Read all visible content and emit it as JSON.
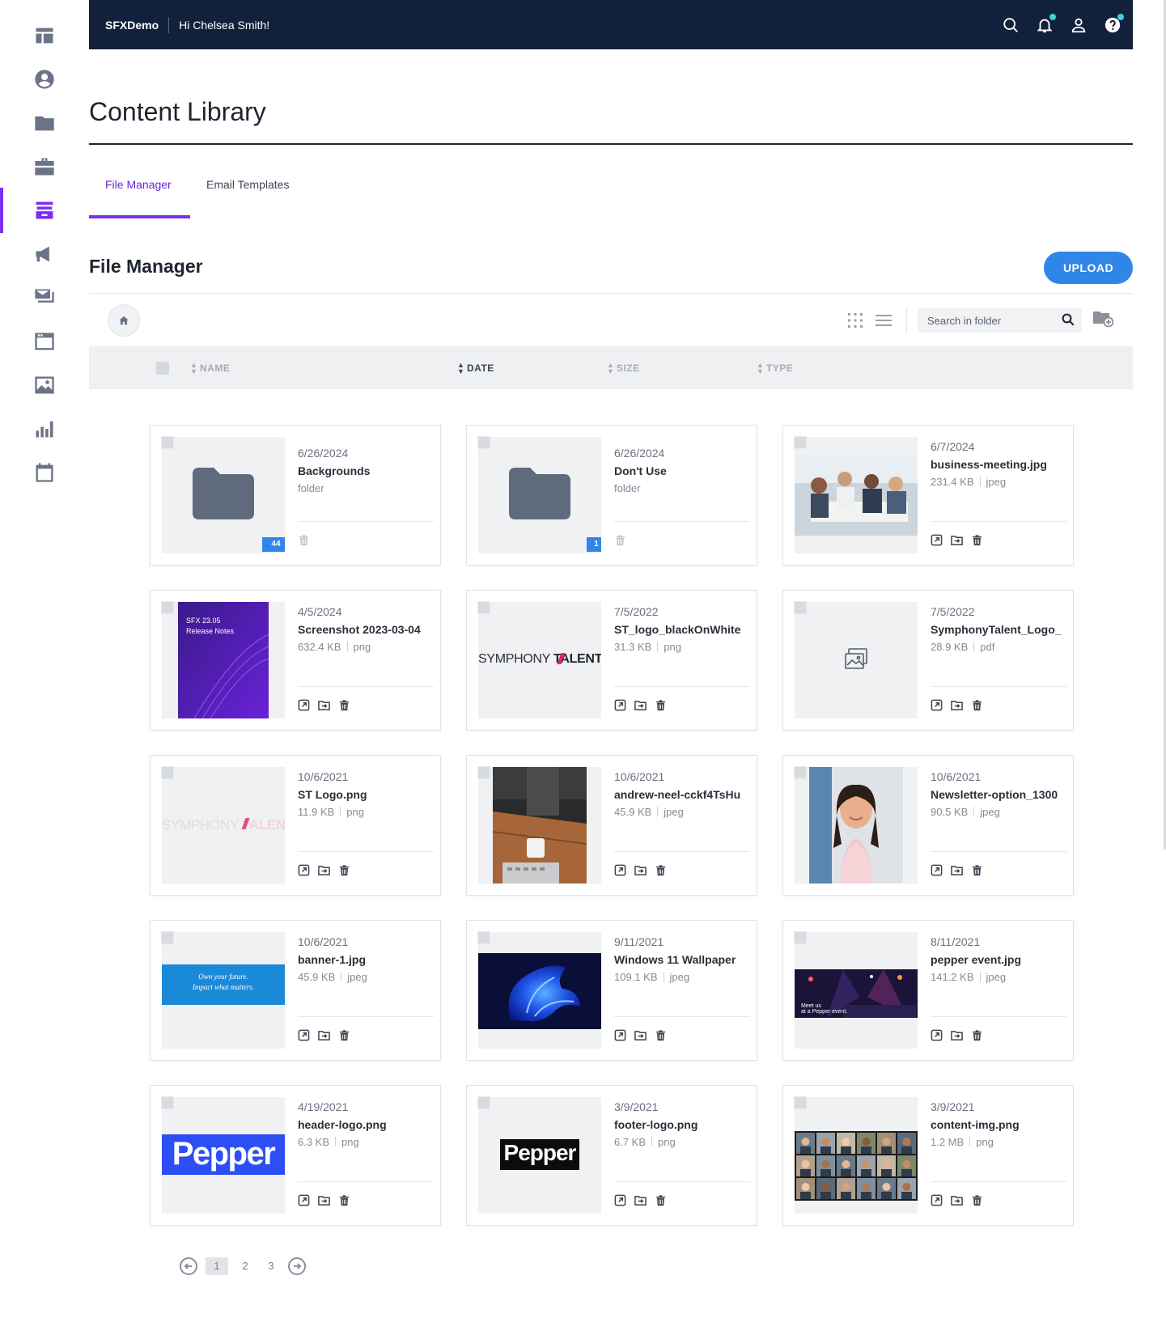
{
  "app": {
    "brand": "SFXDemo",
    "greeting": "Hi Chelsea Smith!"
  },
  "sidebar": {
    "items": [
      {
        "icon": "dashboard-icon"
      },
      {
        "icon": "user-circle-icon"
      },
      {
        "icon": "folder-icon"
      },
      {
        "icon": "briefcase-icon"
      },
      {
        "icon": "archive-icon",
        "active": true
      },
      {
        "icon": "megaphone-icon"
      },
      {
        "icon": "mail-stack-icon"
      },
      {
        "icon": "browser-window-icon"
      },
      {
        "icon": "image-icon"
      },
      {
        "icon": "bar-chart-icon"
      },
      {
        "icon": "calendar-icon"
      }
    ]
  },
  "page": {
    "title": "Content Library"
  },
  "tabs": [
    {
      "label": "File Manager",
      "active": true
    },
    {
      "label": "Email Templates",
      "active": false
    }
  ],
  "section": {
    "title": "File Manager",
    "upload_label": "UPLOAD"
  },
  "toolbar": {
    "search_placeholder": "Search in folder"
  },
  "columns": {
    "name": "NAME",
    "date": "DATE",
    "size": "SIZE",
    "type": "TYPE"
  },
  "files": [
    {
      "date": "6/26/2024",
      "name": "Backgrounds",
      "kind": "folder",
      "meta_type": "folder",
      "count": "44"
    },
    {
      "date": "6/26/2024",
      "name": "Don't Use",
      "kind": "folder",
      "meta_type": "folder",
      "count": "1"
    },
    {
      "date": "6/7/2024",
      "name": "business-meeting.jpg",
      "size": "231.4 KB",
      "meta_type": "jpeg",
      "thumb": "meeting"
    },
    {
      "date": "4/5/2024",
      "name": "Screenshot 2023-03-04",
      "size": "632.4 KB",
      "meta_type": "png",
      "thumb": "release",
      "thumb_text": [
        "SFX 23.05",
        "Release Notes"
      ]
    },
    {
      "date": "7/5/2022",
      "name": "ST_logo_blackOnWhite",
      "size": "31.3 KB",
      "meta_type": "png",
      "thumb": "symphony-dark",
      "thumb_text": [
        "SYMPHONY",
        "TALENT"
      ]
    },
    {
      "date": "7/5/2022",
      "name": "SymphonyTalent_Logo_",
      "size": "28.9 KB",
      "meta_type": "pdf",
      "thumb": "placeholder"
    },
    {
      "date": "10/6/2021",
      "name": "ST Logo.png",
      "size": "11.9 KB",
      "meta_type": "png",
      "thumb": "symphony-light",
      "thumb_text": [
        "SYMPHONY",
        "TALENT"
      ]
    },
    {
      "date": "10/6/2021",
      "name": "andrew-neel-cckf4TsHu",
      "size": "45.9 KB",
      "meta_type": "jpeg",
      "thumb": "desk"
    },
    {
      "date": "10/6/2021",
      "name": "Newsletter-option_1300",
      "size": "90.5 KB",
      "meta_type": "jpeg",
      "thumb": "portrait"
    },
    {
      "date": "10/6/2021",
      "name": "banner-1.jpg",
      "size": "45.9 KB",
      "meta_type": "jpeg",
      "thumb": "banner",
      "thumb_text": [
        "Own your future.",
        "Impact what matters."
      ]
    },
    {
      "date": "9/11/2021",
      "name": "Windows 11 Wallpaper",
      "size": "109.1 KB",
      "meta_type": "jpeg",
      "thumb": "bloom"
    },
    {
      "date": "8/11/2021",
      "name": "pepper event.jpg",
      "size": "141.2 KB",
      "meta_type": "jpeg",
      "thumb": "event",
      "thumb_text": [
        "Meet us",
        "at a Pepper event."
      ]
    },
    {
      "date": "4/19/2021",
      "name": "header-logo.png",
      "size": "6.3 KB",
      "meta_type": "png",
      "thumb": "pepper-blue",
      "thumb_text": [
        "Pepper"
      ]
    },
    {
      "date": "3/9/2021",
      "name": "footer-logo.png",
      "size": "6.7 KB",
      "meta_type": "png",
      "thumb": "pepper-black",
      "thumb_text": [
        "Pepper"
      ]
    },
    {
      "date": "3/9/2021",
      "name": "content-img.png",
      "size": "1.2 MB",
      "meta_type": "png",
      "thumb": "grid"
    }
  ],
  "pagination": {
    "pages": [
      "1",
      "2",
      "3"
    ],
    "current": "1"
  },
  "colors": {
    "accent": "#7b2ff2",
    "topbar": "#12213b",
    "primary": "#2f86e8"
  }
}
